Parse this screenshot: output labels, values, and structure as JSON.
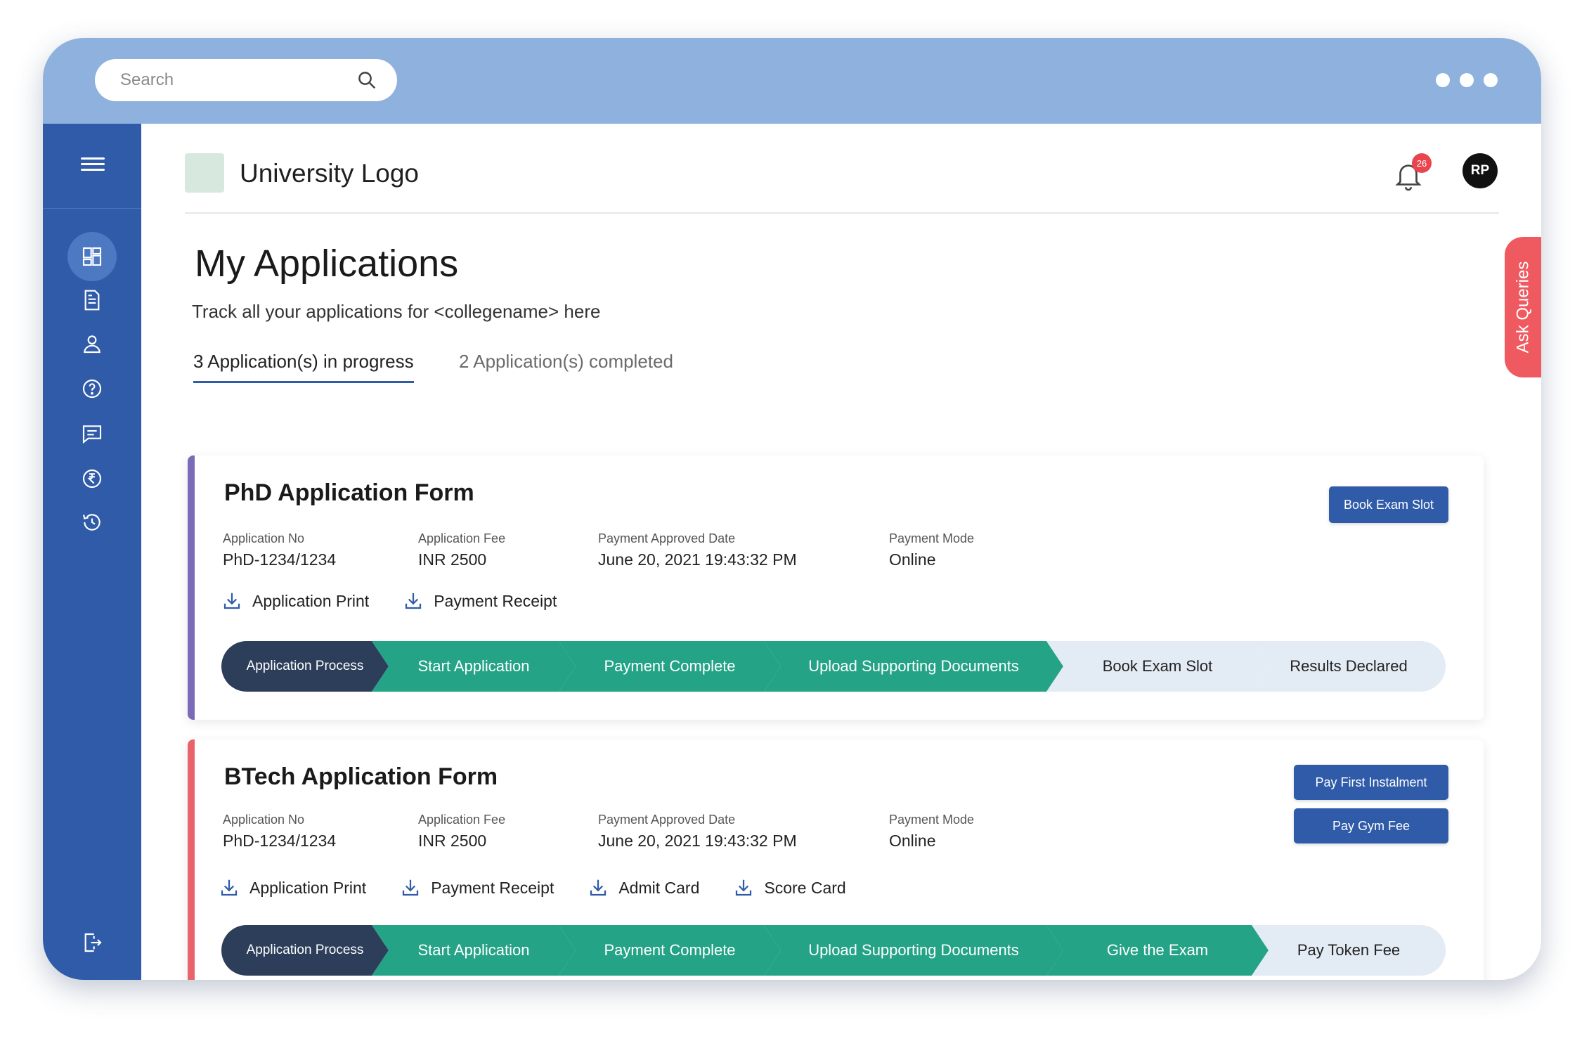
{
  "search": {
    "placeholder": "Search"
  },
  "header": {
    "logo_text": "University Logo",
    "notification_count": "26",
    "avatar_initials": "RP"
  },
  "page": {
    "title": "My Applications",
    "subtitle": "Track all your applications for <collegename> here",
    "tabs": [
      {
        "label": "3 Application(s) in progress",
        "active": true
      },
      {
        "label": "2 Application(s) completed",
        "active": false
      }
    ]
  },
  "ask_queries": "Ask Queries",
  "sidebar": {
    "icons": [
      "menu-icon",
      "dashboard-icon",
      "document-icon",
      "user-icon",
      "help-icon",
      "chat-icon",
      "rupee-icon",
      "history-icon",
      "logout-icon"
    ]
  },
  "labels": {
    "application_no": "Application No",
    "application_fee": "Application Fee",
    "payment_approved_date": "Payment Approved Date",
    "payment_mode": "Payment Mode"
  },
  "cards": [
    {
      "title": "PhD Application Form",
      "application_no": "PhD-1234/1234",
      "application_fee": "INR 2500",
      "payment_approved_date": "June 20, 2021 19:43:32 PM",
      "payment_mode": "Online",
      "downloads": [
        "Application Print",
        "Payment Receipt"
      ],
      "buttons": [
        "Book Exam Slot"
      ],
      "steps": [
        {
          "label": "Application Process",
          "status": "header"
        },
        {
          "label": "Start Application",
          "status": "done"
        },
        {
          "label": "Payment Complete",
          "status": "done"
        },
        {
          "label": "Upload Supporting Documents",
          "status": "done"
        },
        {
          "label": "Book Exam Slot",
          "status": "pending"
        },
        {
          "label": "Results Declared",
          "status": "pending"
        }
      ]
    },
    {
      "title": "BTech Application Form",
      "application_no": "PhD-1234/1234",
      "application_fee": "INR 2500",
      "payment_approved_date": "June 20, 2021 19:43:32 PM",
      "payment_mode": "Online",
      "downloads": [
        "Application Print",
        "Payment Receipt",
        "Admit Card",
        "Score Card"
      ],
      "buttons": [
        "Pay First Instalment",
        "Pay Gym Fee"
      ],
      "steps": [
        {
          "label": "Application Process",
          "status": "header"
        },
        {
          "label": "Start Application",
          "status": "done"
        },
        {
          "label": "Payment Complete",
          "status": "done"
        },
        {
          "label": "Upload Supporting Documents",
          "status": "done"
        },
        {
          "label": "Give the Exam",
          "status": "done"
        },
        {
          "label": "Pay Token Fee",
          "status": "pending"
        }
      ]
    }
  ],
  "colors": {
    "topbar": "#8fb1dd",
    "sidebar": "#2f5ba8",
    "primary_button": "#2f5ba8",
    "step_done": "#24a386",
    "step_pending": "#e3ebf4",
    "step_header": "#2c3e5a",
    "ask_queries": "#ee5a60",
    "badge": "#e8454f"
  }
}
